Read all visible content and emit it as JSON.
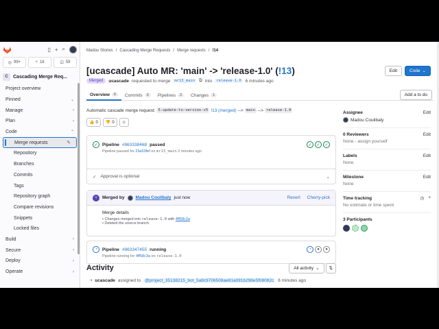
{
  "sidebar": {
    "counts": [
      {
        "icon": "issues-icon",
        "value": "99+"
      },
      {
        "icon": "merge-request-icon",
        "value": "18"
      },
      {
        "icon": "todo-icon",
        "value": "59"
      }
    ],
    "project_initial": "C",
    "project_name": "Cascading Merge Req...",
    "items": [
      {
        "label": "Project overview"
      },
      {
        "label": "Pinned"
      },
      {
        "label": "Manage"
      },
      {
        "label": "Plan"
      },
      {
        "label": "Code"
      },
      {
        "label": "Merge requests"
      },
      {
        "label": "Repository"
      },
      {
        "label": "Branches"
      },
      {
        "label": "Commits"
      },
      {
        "label": "Tags"
      },
      {
        "label": "Repository graph"
      },
      {
        "label": "Compare revisions"
      },
      {
        "label": "Snippets"
      },
      {
        "label": "Locked files"
      },
      {
        "label": "Build"
      },
      {
        "label": "Secure"
      },
      {
        "label": "Deploy"
      },
      {
        "label": "Operate"
      }
    ]
  },
  "breadcrumb": {
    "items": [
      "Madou Stories",
      "Cascading Merge Requests",
      "Merge requests",
      "!14"
    ]
  },
  "header": {
    "title_prefix": "[ucascade] Auto MR: 'main' -> 'release-1.0' (",
    "title_iid": "!13",
    "title_suffix": ")",
    "edit_label": "Edit",
    "code_label": "Code"
  },
  "meta": {
    "status": "Merged",
    "author": "ucascade",
    "requested_text": "requested to merge",
    "source_branch": "mr13_main",
    "into_text": "into",
    "target_branch": "release-1.0",
    "time": "6 minutes ago"
  },
  "tabs": [
    {
      "label": "Overview",
      "count": "0"
    },
    {
      "label": "Commits",
      "count": "3"
    },
    {
      "label": "Pipelines",
      "count": "2"
    },
    {
      "label": "Changes",
      "count": "1"
    }
  ],
  "todo_label": "Add a to do",
  "description": {
    "prefix": "Automatic cascade merge request:",
    "branch": "5-update-to-version-v5",
    "mr_link": "!13 (merged)",
    "arrow1": "-->",
    "main": "main",
    "arrow2": "-->",
    "release": "release-1.0"
  },
  "reactions": [
    {
      "icon": "thumbs-up-icon",
      "emoji": "👍",
      "count": "0"
    },
    {
      "icon": "thumbs-down-icon",
      "emoji": "👎",
      "count": "0"
    }
  ],
  "pipeline1": {
    "label": "Pipeline",
    "id": "#963338468",
    "status": "passed",
    "sub_text": "Pipeline passed for",
    "commit": "23a53fef",
    "on_text": "on",
    "branch": "mr13_main",
    "time": "2 minutes ago"
  },
  "approval": {
    "text": "Approval is optional"
  },
  "merged": {
    "by_text": "Merged by",
    "user": "Madou Coulibaly",
    "when": "just now",
    "revert": "Revert",
    "cherry": "Cherry-pick",
    "details_title": "Merge details",
    "detail1_prefix": "Changes merged into",
    "detail1_branch": "release-1.0",
    "detail1_with": "with",
    "detail1_commit": "4ff58c3a",
    "detail2": "Deleted the source branch."
  },
  "pipeline2": {
    "label": "Pipeline",
    "id": "#963347455",
    "status": "running",
    "sub_text": "Pipeline running for",
    "commit": "4ff58c3a",
    "on_text": "on",
    "branch": "release-1.0"
  },
  "activity": {
    "title": "Activity",
    "filter": "All activity",
    "event_user": "ucascade",
    "event_text": "assigned to",
    "event_mention": "@project_35138215_bot_5a9c9706508ae81a091b298e5f08082c",
    "event_time": "6 minutes ago"
  },
  "right": {
    "assignee_title": "Assignee",
    "assignee_name": "Madou Coulibaly",
    "reviewers_title": "0 Reviewers",
    "reviewers_value": "None - assign yourself",
    "labels_title": "Labels",
    "labels_value": "None",
    "milestone_title": "Milestone",
    "milestone_value": "None",
    "time_title": "Time tracking",
    "time_value": "No estimate or time spent",
    "participants_title": "3 Participants",
    "edit_label": "Edit"
  },
  "colors": {
    "accent": "#1f75cb",
    "merged": "#5943b6",
    "success": "#108548"
  }
}
